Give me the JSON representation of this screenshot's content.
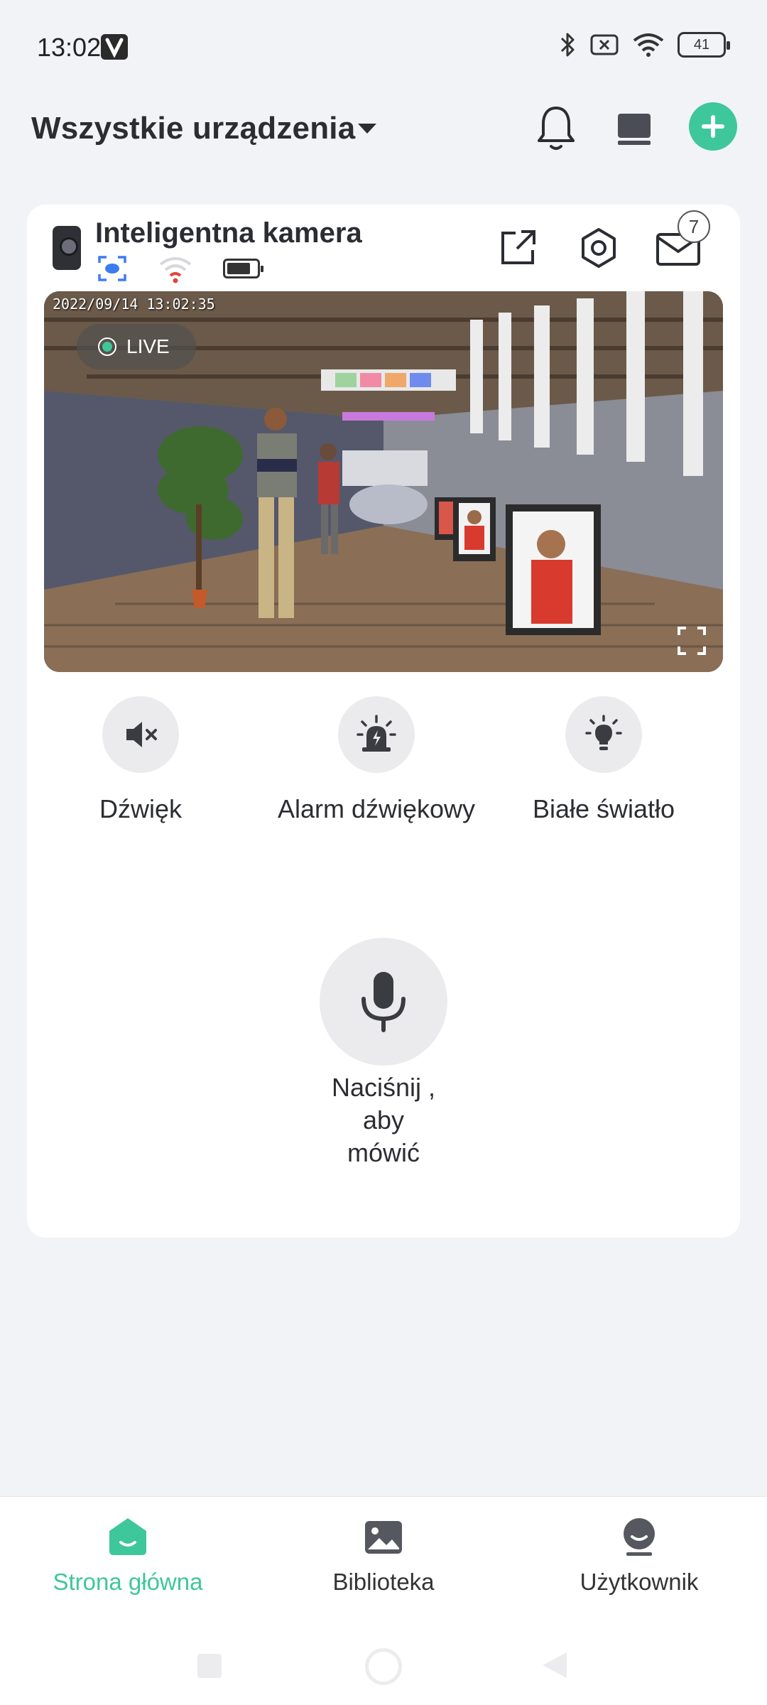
{
  "status_bar": {
    "time": "13:02",
    "battery": "41"
  },
  "header": {
    "title": "Wszystkie urządzenia"
  },
  "device": {
    "name": "Inteligentna kamera",
    "message_count": "7",
    "video": {
      "timestamp": "2022/09/14  13:02:35",
      "live_label": "LIVE"
    }
  },
  "controls": [
    {
      "label": "Dźwięk",
      "icon": "speaker-muted-icon"
    },
    {
      "label": "Alarm dźwiękowy",
      "icon": "siren-icon"
    },
    {
      "label": "Białe światło",
      "icon": "light-bulb-icon"
    }
  ],
  "talk": {
    "line1": "Naciśnij ,",
    "line2": "aby",
    "line3": "mówić"
  },
  "nav": {
    "items": [
      {
        "label": "Strona główna",
        "icon": "home-icon",
        "active": true
      },
      {
        "label": "Biblioteka",
        "icon": "gallery-icon",
        "active": false
      },
      {
        "label": "Użytkownik",
        "icon": "user-icon",
        "active": false
      }
    ]
  },
  "colors": {
    "accent": "#3ec79a",
    "background": "#f2f3f6",
    "card": "#ffffff"
  }
}
